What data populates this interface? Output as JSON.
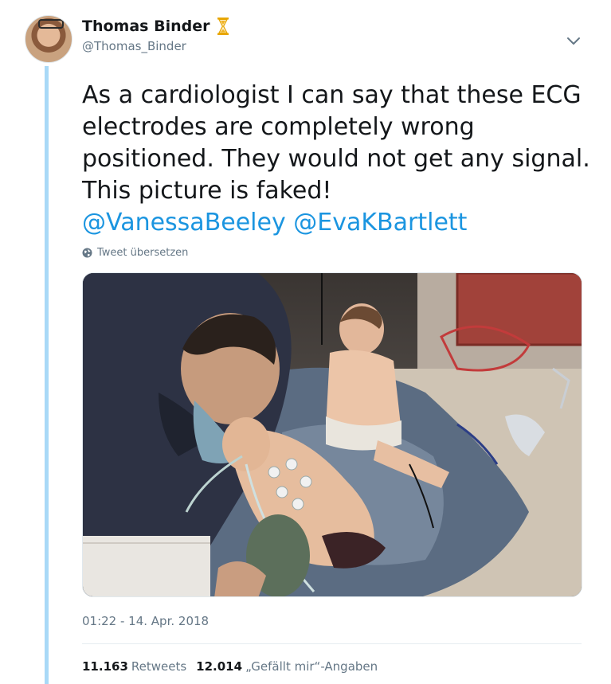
{
  "tweet": {
    "author_name": "Thomas Binder",
    "author_handle": "@Thomas_Binder",
    "name_badge_icon": "hourglass-icon",
    "text_parts": [
      "As a cardiologist I can say that these ECG electrodes are completely wrong positioned. They would not get any signal. This picture is faked!"
    ],
    "mentions": [
      "@VanessaBeeley",
      "@EvaKBartlett"
    ],
    "translate_label": "Tweet übersetzen",
    "timestamp": "01:22 - 14. Apr. 2018",
    "stats": {
      "retweets_count": "11.163",
      "retweets_label": "Retweets",
      "likes_count": "12.014",
      "likes_label": "„Gefällt mir“-Angaben"
    }
  },
  "colors": {
    "link": "#1b95e0",
    "thread_line": "#a9d9f7",
    "muted": "#657786",
    "hourglass": "#e8a600"
  },
  "icons": {
    "menu": "chevron-down-icon",
    "translate": "globe-icon"
  }
}
